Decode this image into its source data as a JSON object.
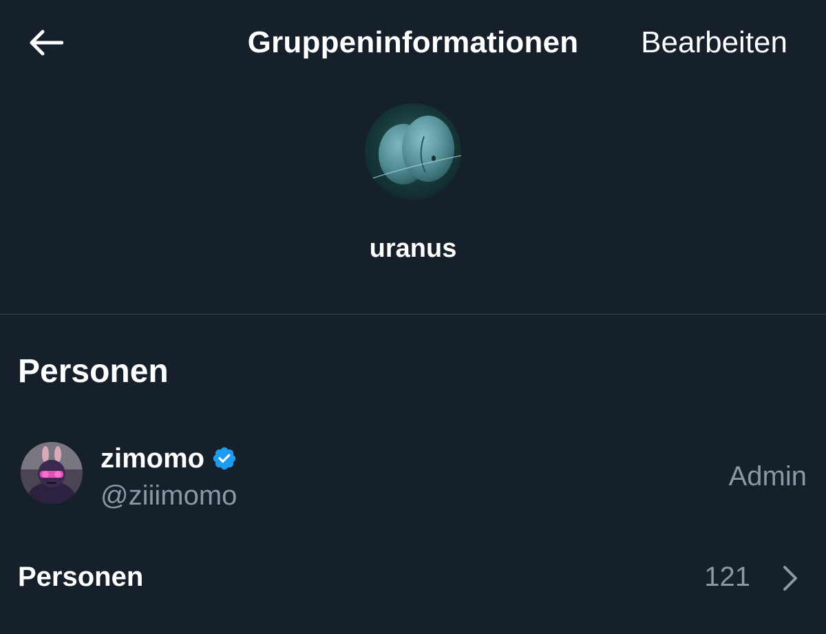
{
  "header": {
    "back_icon": "arrow-left-icon",
    "title": "Gruppeninformationen",
    "edit_label": "Bearbeiten"
  },
  "group": {
    "avatar_icon": "planet-avatar",
    "name": "uranus"
  },
  "people_section": {
    "title": "Personen",
    "members": [
      {
        "name": "zimomo",
        "handle": "@ziiimomo",
        "role": "Admin",
        "verified": true,
        "verified_color": "#1d9bf0"
      }
    ],
    "all_people": {
      "label": "Personen",
      "count": "121",
      "chevron_icon": "chevron-right-icon"
    }
  },
  "colors": {
    "background": "#15202b",
    "text_primary": "#ffffff",
    "text_secondary": "#8b98a5",
    "divider": "#38444d",
    "accent": "#1d9bf0"
  }
}
